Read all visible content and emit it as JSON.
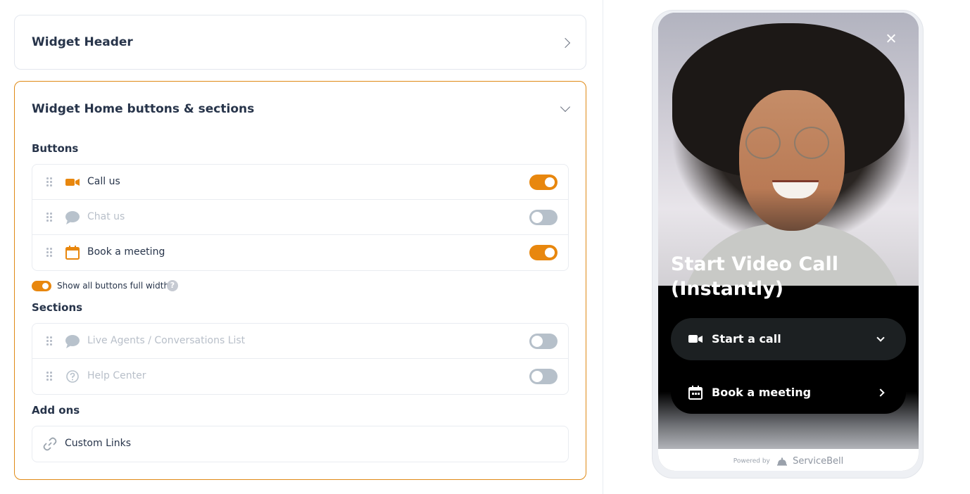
{
  "settings": {
    "header_card": {
      "title": "Widget Header"
    },
    "home_card": {
      "title": "Widget Home buttons & sections",
      "buttons_label": "Buttons",
      "buttons": [
        {
          "label": "Call us",
          "icon": "video-camera-icon",
          "enabled": true
        },
        {
          "label": "Chat us",
          "icon": "chat-bubble-icon",
          "enabled": false
        },
        {
          "label": "Book a meeting",
          "icon": "calendar-icon",
          "enabled": true
        }
      ],
      "full_width_label": "Show all buttons full width",
      "full_width_enabled": true,
      "help_glyph": "?",
      "sections_label": "Sections",
      "sections": [
        {
          "label": "Live Agents / Conversations List",
          "icon": "chat-bubble-icon",
          "enabled": false
        },
        {
          "label": "Help Center",
          "icon": "question-circle-icon",
          "enabled": false
        }
      ],
      "addons_label": "Add ons",
      "addons": [
        {
          "label": "Custom Links",
          "icon": "link-icon"
        }
      ]
    }
  },
  "preview": {
    "headline": "Start Video Call (Instantly)",
    "call_button": "Start a call",
    "book_button": "Book a meeting",
    "powered_by": "Powered by",
    "brand": "ServiceBell"
  },
  "colors": {
    "accent": "#e8870e",
    "toggle_off": "#b6c0ca",
    "text": "#27344a",
    "muted_text": "#b8bfc9"
  }
}
